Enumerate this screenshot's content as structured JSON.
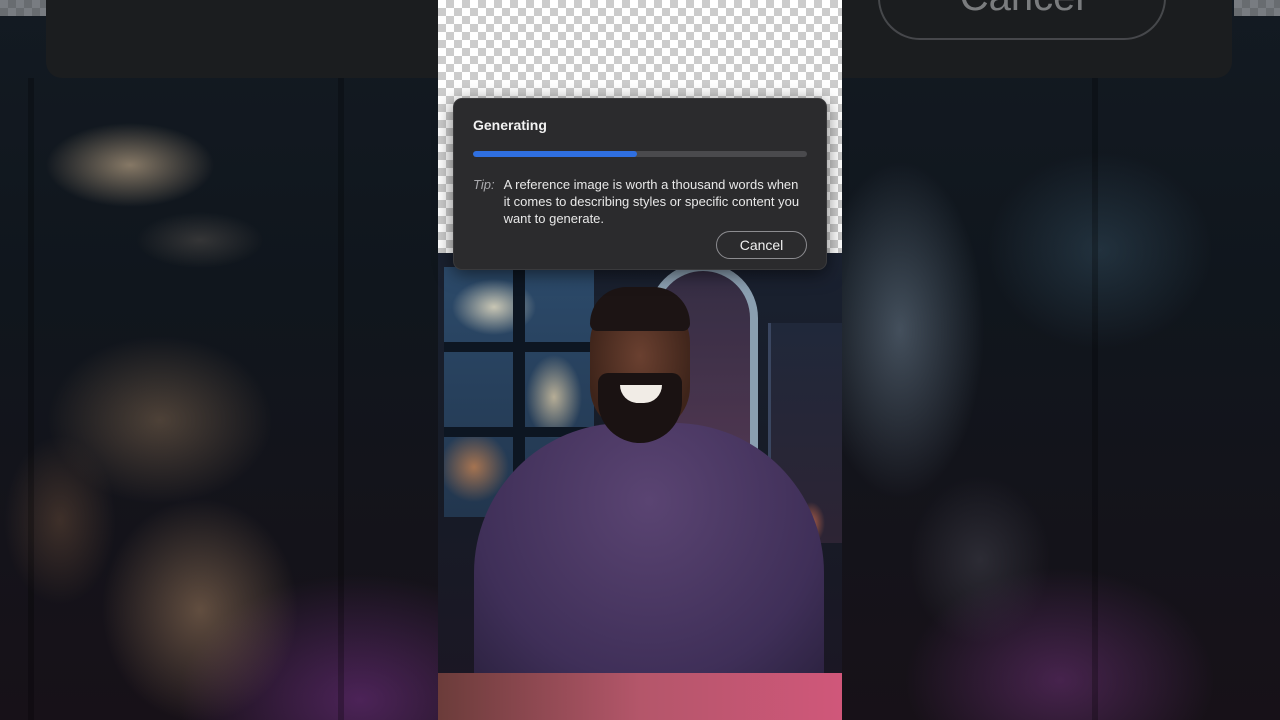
{
  "background": {
    "blurred_cancel_label": "Cancel"
  },
  "dialog": {
    "title": "Generating",
    "progress_percent": 49,
    "tip_label": "Tip:",
    "tip_text": "A reference image is worth a thousand words when it comes to describing styles or specific content you want to generate.",
    "cancel_label": "Cancel"
  },
  "colors": {
    "accent": "#2f6fe0",
    "dialog_bg": "#2b2b2d"
  }
}
